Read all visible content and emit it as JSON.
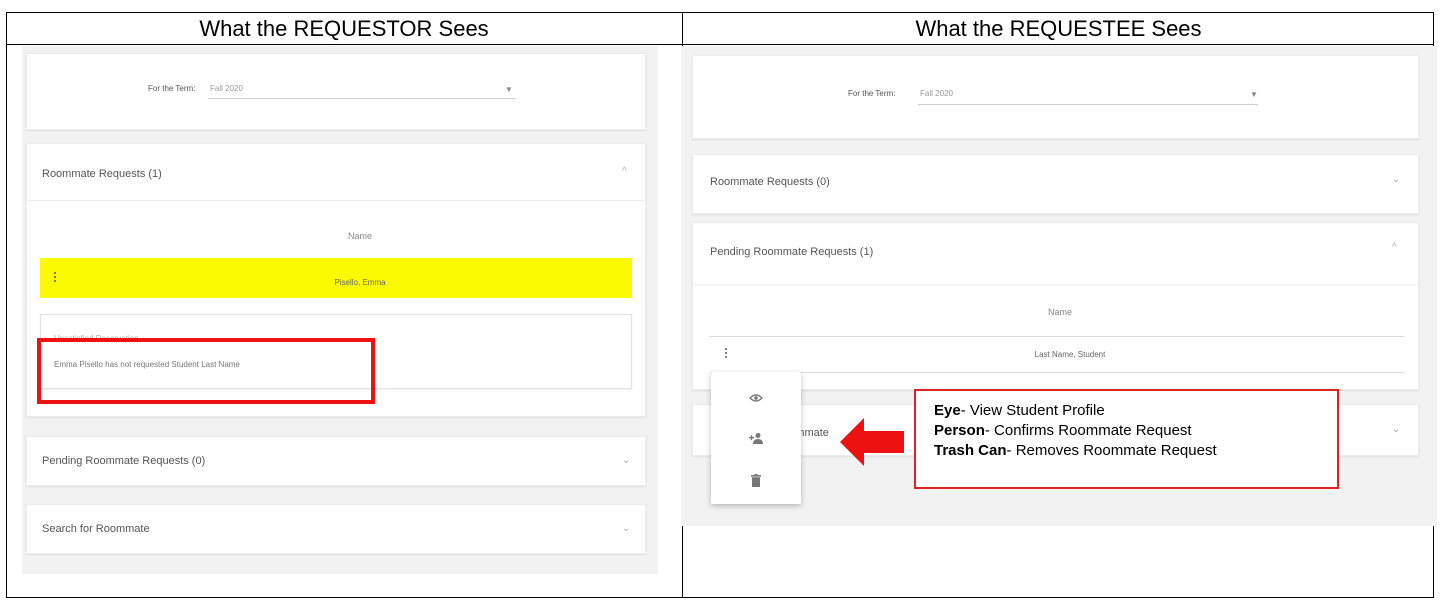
{
  "headers": {
    "left": "What the REQUESTOR Sees",
    "right": "What the REQUESTEE Sees"
  },
  "requestor": {
    "term_label": "For the Term:",
    "term_value": "Fall 2020",
    "roommate_requests": "Roommate Requests (1)",
    "table_header": "Name",
    "row_name": "Pisello, Emma",
    "unsatisfied_title": "Unsatisfied Reservation",
    "unsatisfied_message": "Emma Pisello has not requested Student Last Name",
    "pending_requests": "Pending Roommate Requests (0)",
    "search": "Search for Roommate"
  },
  "requestee": {
    "term_label": "For the Term:",
    "term_value": "Fall 2020",
    "roommate_requests": "Roommate Requests (0)",
    "pending_requests": "Pending Roommate Requests (1)",
    "table_header": "Name",
    "row_name": "Last Name, Student",
    "obscured_section": "...ommate"
  },
  "menu_icons": [
    "eye-icon",
    "person-add-icon",
    "trash-can-icon"
  ],
  "legend": [
    {
      "term": "Eye",
      "desc": "- View Student Profile"
    },
    {
      "term": "Person",
      "desc": "- Confirms Roommate Request"
    },
    {
      "term": "Trash Can",
      "desc": "- Removes Roommate Request"
    }
  ],
  "colors": {
    "highlight": "#fbfb00",
    "callout_red": "#ee1111"
  }
}
